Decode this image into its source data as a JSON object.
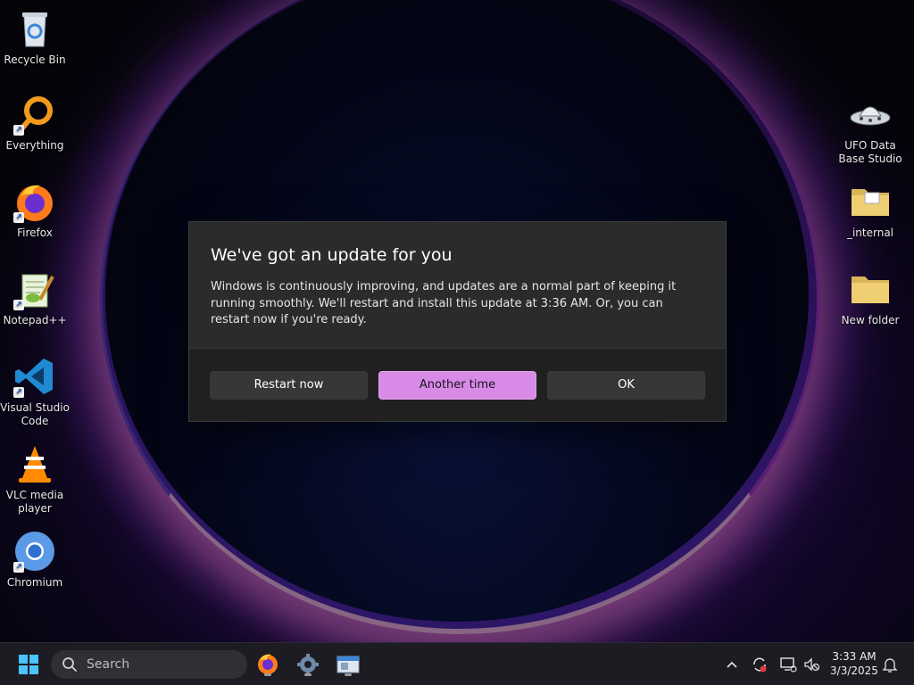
{
  "desktop": {
    "icons_left": [
      {
        "label": "Recycle Bin",
        "icon": "recycle-bin-icon"
      },
      {
        "label": "Everything",
        "icon": "everything-search-icon"
      },
      {
        "label": "Firefox",
        "icon": "firefox-icon"
      },
      {
        "label": "Notepad++",
        "icon": "notepad-plus-plus-icon"
      },
      {
        "label": "Visual Studio Code",
        "icon": "vscode-icon"
      },
      {
        "label": "VLC media player",
        "icon": "vlc-icon"
      },
      {
        "label": "Chromium",
        "icon": "chromium-icon"
      }
    ],
    "icons_right": [
      {
        "label": "UFO Data Base Studio",
        "icon": "ufo-icon"
      },
      {
        "label": "_internal",
        "icon": "folder-icon"
      },
      {
        "label": "New folder",
        "icon": "folder-icon"
      }
    ]
  },
  "dialog": {
    "title": "We've got an update for you",
    "body": "Windows is continuously improving, and updates are a normal part of keeping it running smoothly. We'll restart and install this update at 3:36 AM. Or, you can restart now if you're ready.",
    "buttons": {
      "restart": "Restart now",
      "another_time": "Another time",
      "ok": "OK"
    },
    "accent_color": "#d78be6"
  },
  "taskbar": {
    "search_placeholder": "Search",
    "pinned": [
      "firefox-icon",
      "settings-gear-icon",
      "file-explorer-icon"
    ],
    "tray": [
      "chevron-up-icon",
      "sync-alert-icon",
      "network-icon",
      "volume-muted-icon",
      "notification-bell-icon"
    ],
    "time": "3:33 AM",
    "date": "3/3/2025"
  }
}
